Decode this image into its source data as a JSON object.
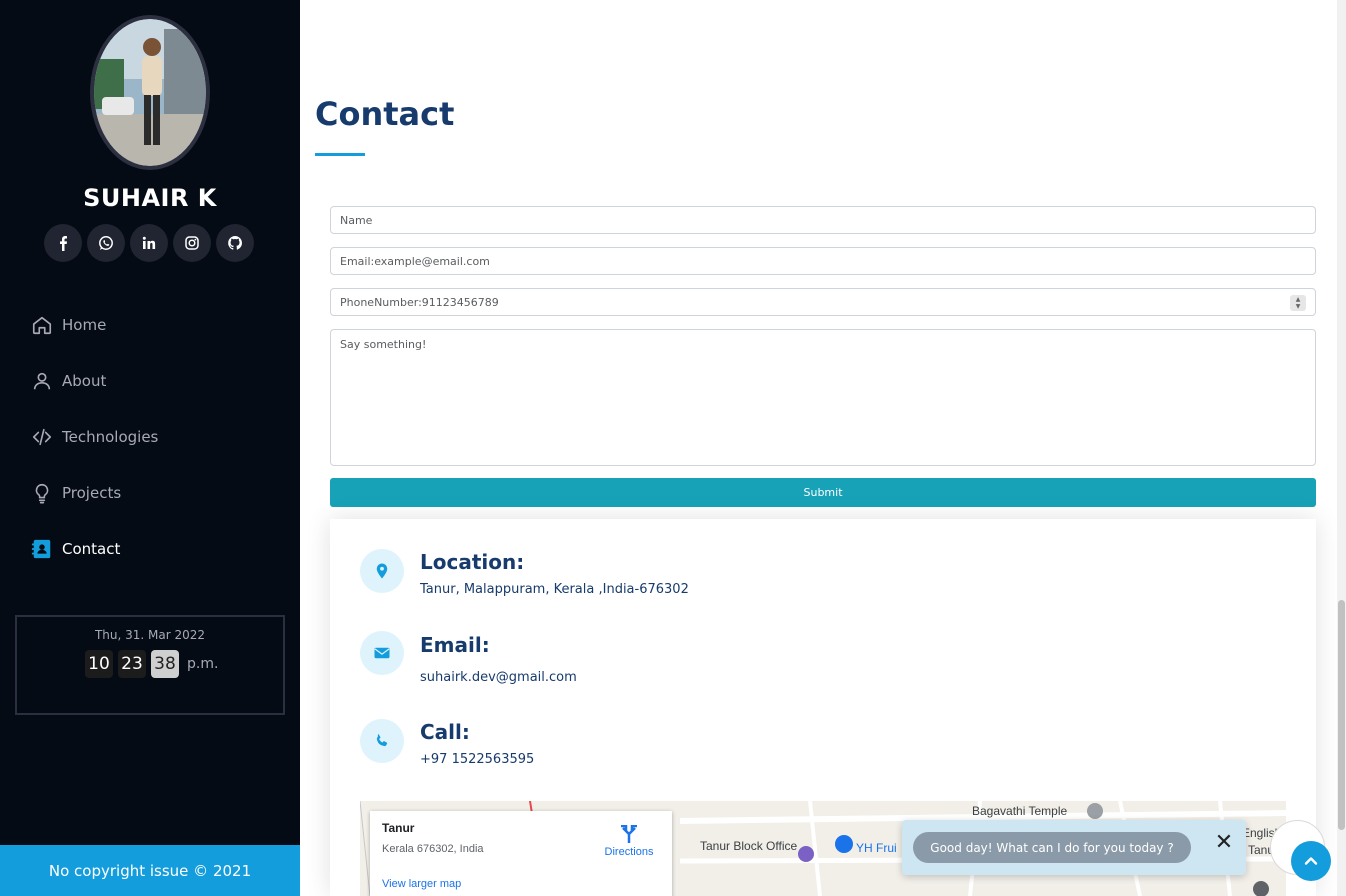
{
  "profile": {
    "name": "SUHAIR K"
  },
  "social": [
    {
      "icon": "facebook-icon"
    },
    {
      "icon": "whatsapp-icon"
    },
    {
      "icon": "linkedin-icon"
    },
    {
      "icon": "instagram-icon"
    },
    {
      "icon": "github-icon"
    }
  ],
  "nav": [
    {
      "label": "Home",
      "icon": "home-icon"
    },
    {
      "label": "About",
      "icon": "user-icon"
    },
    {
      "label": "Technologies",
      "icon": "code-icon"
    },
    {
      "label": "Projects",
      "icon": "lightbulb-icon"
    },
    {
      "label": "Contact",
      "icon": "contact-card-icon",
      "active": true
    }
  ],
  "clock": {
    "date": "Thu, 31. Mar 2022",
    "hours": "10",
    "minutes": "23",
    "seconds": "38",
    "ampm": "p.m."
  },
  "footer": {
    "text": "No copyright issue © 2021"
  },
  "contact": {
    "title": "Contact",
    "form": {
      "name_placeholder": "Name",
      "email_placeholder": "Email:example@email.com",
      "phone_placeholder": "PhoneNumber:91123456789",
      "message_placeholder": "Say something!",
      "submit_label": "Submit"
    },
    "location": {
      "heading": "Location:",
      "text": "Tanur, Malappuram, Kerala ,India-676302"
    },
    "email": {
      "heading": "Email:",
      "text": "suhairk.dev@gmail.com"
    },
    "call": {
      "heading": "Call:",
      "text": "+97 1522563595"
    }
  },
  "map": {
    "place": "Tanur",
    "address": "Kerala 676302, India",
    "directions_label": "Directions",
    "larger_map_label": "View larger map",
    "labels": [
      "Bagavathi Temple",
      "Tanur Block Office",
      "YH Frui",
      "English",
      "Tanu"
    ]
  },
  "chat": {
    "message": "Good day! What can I do for you today ?"
  },
  "colors": {
    "accent": "#149ddd",
    "sidebar_bg": "#040b14",
    "heading": "#173b6c",
    "submit": "#17a2b8"
  }
}
